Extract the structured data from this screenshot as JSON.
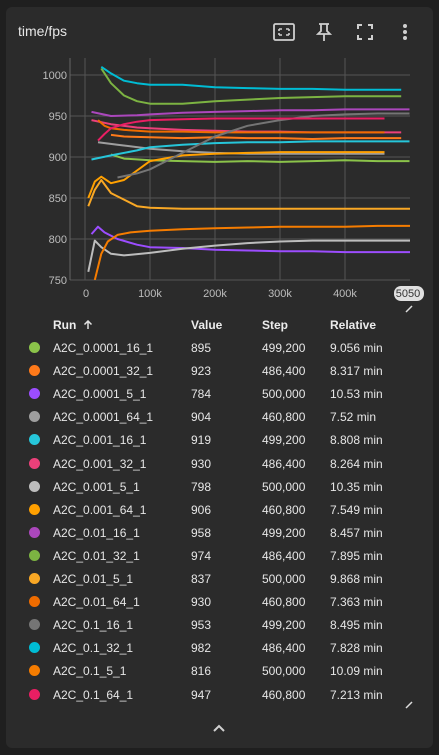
{
  "card": {
    "title": "time/fps"
  },
  "toolbar": {
    "fit_icon": "fit-domain-icon",
    "pin_icon": "pin-icon",
    "fullscreen_icon": "fullscreen-icon",
    "menu_icon": "more-vert-icon"
  },
  "chart_data": {
    "type": "line",
    "ylim": [
      750,
      1020
    ],
    "yticks": [
      "1000",
      "950",
      "900",
      "850",
      "800",
      "750"
    ],
    "xlim": [
      0,
      500000
    ],
    "xticks": [
      "0",
      "100k",
      "200k",
      "300k",
      "400k",
      "5050"
    ],
    "grid": true,
    "series": [
      {
        "name": "A2C_0.0001_16_1",
        "color": "#8bc34a",
        "x": [
          40000,
          60000,
          100000,
          150000,
          200000,
          250000,
          300000,
          350000,
          400000,
          450000,
          499200
        ],
        "y": [
          903,
          898,
          896,
          895,
          894,
          895,
          894,
          895,
          896,
          895,
          895
        ]
      },
      {
        "name": "A2C_0.0001_32_1",
        "color": "#ff7a1a",
        "x": [
          40000,
          60000,
          100000,
          150000,
          200000,
          250000,
          300000,
          350000,
          400000,
          450000,
          486400
        ],
        "y": [
          927,
          925,
          924,
          923,
          924,
          923,
          923,
          922,
          923,
          923,
          923
        ]
      },
      {
        "name": "A2C_0.0001_5_1",
        "color": "#9c4dff",
        "x": [
          10000,
          20000,
          30000,
          50000,
          80000,
          100000,
          150000,
          200000,
          250000,
          300000,
          350000,
          400000,
          450000,
          500000
        ],
        "y": [
          806,
          815,
          808,
          800,
          793,
          790,
          789,
          787,
          786,
          785,
          785,
          784,
          784,
          784
        ]
      },
      {
        "name": "A2C_0.0001_64_1",
        "color": "#9e9e9e",
        "x": [
          20000,
          50000,
          100000,
          150000,
          200000,
          250000,
          300000,
          350000,
          400000,
          460800
        ],
        "y": [
          918,
          915,
          910,
          907,
          905,
          904,
          904,
          904,
          904,
          904
        ]
      },
      {
        "name": "A2C_0.001_16_1",
        "color": "#26c6da",
        "x": [
          10000,
          40000,
          80000,
          100000,
          150000,
          200000,
          250000,
          300000,
          350000,
          400000,
          450000,
          499200
        ],
        "y": [
          897,
          902,
          908,
          912,
          915,
          917,
          918,
          918,
          919,
          919,
          919,
          919
        ]
      },
      {
        "name": "A2C_0.001_32_1",
        "color": "#ec407a",
        "x": [
          10000,
          40000,
          80000,
          100000,
          150000,
          200000,
          250000,
          300000,
          350000,
          400000,
          450000,
          486400
        ],
        "y": [
          945,
          940,
          936,
          935,
          933,
          932,
          931,
          931,
          930,
          930,
          930,
          930
        ]
      },
      {
        "name": "A2C_0.001_5_1",
        "color": "#bdbdbd",
        "x": [
          5000,
          15000,
          25000,
          40000,
          60000,
          100000,
          150000,
          200000,
          250000,
          300000,
          350000,
          400000,
          450000,
          500000
        ],
        "y": [
          760,
          798,
          790,
          782,
          780,
          783,
          788,
          792,
          795,
          797,
          798,
          798,
          798,
          798
        ]
      },
      {
        "name": "A2C_0.001_64_1",
        "color": "#ffa000",
        "x": [
          5000,
          15000,
          25000,
          40000,
          60000,
          100000,
          150000,
          200000,
          250000,
          300000,
          350000,
          400000,
          460800
        ],
        "y": [
          850,
          870,
          876,
          868,
          872,
          895,
          902,
          904,
          905,
          906,
          906,
          906,
          906
        ]
      },
      {
        "name": "A2C_0.01_16_1",
        "color": "#ab47bc",
        "x": [
          10000,
          40000,
          80000,
          100000,
          150000,
          200000,
          250000,
          300000,
          350000,
          400000,
          450000,
          499200
        ],
        "y": [
          955,
          950,
          951,
          952,
          954,
          955,
          956,
          957,
          957,
          958,
          958,
          958
        ]
      },
      {
        "name": "A2C_0.01_32_1",
        "color": "#7cb342",
        "x": [
          25000,
          40000,
          60000,
          80000,
          100000,
          150000,
          200000,
          250000,
          300000,
          350000,
          400000,
          450000,
          486400
        ],
        "y": [
          1008,
          990,
          975,
          968,
          965,
          965,
          968,
          970,
          972,
          973,
          974,
          974,
          974
        ]
      },
      {
        "name": "A2C_0.01_5_1",
        "color": "#f9a825",
        "x": [
          5000,
          15000,
          25000,
          40000,
          60000,
          80000,
          100000,
          150000,
          200000,
          250000,
          300000,
          350000,
          400000,
          450000,
          500000
        ],
        "y": [
          840,
          860,
          872,
          856,
          848,
          840,
          838,
          837,
          837,
          837,
          837,
          837,
          837,
          837,
          837
        ]
      },
      {
        "name": "A2C_0.01_64_1",
        "color": "#ef6c00",
        "x": [
          20000,
          30000,
          40000,
          60000,
          80000,
          100000,
          150000,
          200000,
          250000,
          300000,
          350000,
          400000,
          460800
        ],
        "y": [
          945,
          938,
          935,
          933,
          932,
          931,
          931,
          930,
          930,
          930,
          930,
          930,
          930
        ]
      },
      {
        "name": "A2C_0.1_16_1",
        "color": "#757575",
        "x": [
          50000,
          80000,
          100000,
          150000,
          200000,
          250000,
          300000,
          350000,
          400000,
          450000,
          499200
        ],
        "y": [
          875,
          880,
          885,
          905,
          925,
          938,
          945,
          950,
          952,
          953,
          953
        ]
      },
      {
        "name": "A2C_0.1_32_1",
        "color": "#00bcd4",
        "x": [
          25000,
          40000,
          60000,
          80000,
          100000,
          150000,
          200000,
          250000,
          300000,
          350000,
          400000,
          450000,
          486400
        ],
        "y": [
          1010,
          1002,
          993,
          990,
          988,
          988,
          985,
          984,
          983,
          983,
          982,
          982,
          982
        ]
      },
      {
        "name": "A2C_0.1_5_1",
        "color": "#f57c00",
        "x": [
          15000,
          25000,
          35000,
          50000,
          70000,
          100000,
          150000,
          200000,
          250000,
          300000,
          350000,
          400000,
          450000,
          500000
        ],
        "y": [
          750,
          782,
          797,
          805,
          808,
          810,
          812,
          813,
          814,
          815,
          815,
          815,
          816,
          816
        ]
      },
      {
        "name": "A2C_0.1_64_1",
        "color": "#e91e63",
        "x": [
          20000,
          30000,
          40000,
          60000,
          80000,
          100000,
          150000,
          200000,
          250000,
          300000,
          350000,
          400000,
          460800
        ],
        "y": [
          920,
          928,
          935,
          940,
          943,
          945,
          946,
          947,
          947,
          947,
          947,
          947,
          947
        ]
      }
    ]
  },
  "table": {
    "headers": {
      "run": "Run",
      "sort_icon": "sort-ascending-icon",
      "value": "Value",
      "step": "Step",
      "relative": "Relative"
    },
    "rows": [
      {
        "run": "A2C_0.0001_16_1",
        "value": "895",
        "step": "499,200",
        "relative": "9.056 min",
        "color": "#8bc34a"
      },
      {
        "run": "A2C_0.0001_32_1",
        "value": "923",
        "step": "486,400",
        "relative": "8.317 min",
        "color": "#ff7a1a"
      },
      {
        "run": "A2C_0.0001_5_1",
        "value": "784",
        "step": "500,000",
        "relative": "10.53 min",
        "color": "#9c4dff"
      },
      {
        "run": "A2C_0.0001_64_1",
        "value": "904",
        "step": "460,800",
        "relative": "7.52 min",
        "color": "#9e9e9e"
      },
      {
        "run": "A2C_0.001_16_1",
        "value": "919",
        "step": "499,200",
        "relative": "8.808 min",
        "color": "#26c6da"
      },
      {
        "run": "A2C_0.001_32_1",
        "value": "930",
        "step": "486,400",
        "relative": "8.264 min",
        "color": "#ec407a"
      },
      {
        "run": "A2C_0.001_5_1",
        "value": "798",
        "step": "500,000",
        "relative": "10.35 min",
        "color": "#bdbdbd"
      },
      {
        "run": "A2C_0.001_64_1",
        "value": "906",
        "step": "460,800",
        "relative": "7.549 min",
        "color": "#ffa000"
      },
      {
        "run": "A2C_0.01_16_1",
        "value": "958",
        "step": "499,200",
        "relative": "8.457 min",
        "color": "#ab47bc"
      },
      {
        "run": "A2C_0.01_32_1",
        "value": "974",
        "step": "486,400",
        "relative": "7.895 min",
        "color": "#7cb342"
      },
      {
        "run": "A2C_0.01_5_1",
        "value": "837",
        "step": "500,000",
        "relative": "9.868 min",
        "color": "#f9a825"
      },
      {
        "run": "A2C_0.01_64_1",
        "value": "930",
        "step": "460,800",
        "relative": "7.363 min",
        "color": "#ef6c00"
      },
      {
        "run": "A2C_0.1_16_1",
        "value": "953",
        "step": "499,200",
        "relative": "8.495 min",
        "color": "#757575"
      },
      {
        "run": "A2C_0.1_32_1",
        "value": "982",
        "step": "486,400",
        "relative": "7.828 min",
        "color": "#00bcd4"
      },
      {
        "run": "A2C_0.1_5_1",
        "value": "816",
        "step": "500,000",
        "relative": "10.09 min",
        "color": "#f57c00"
      },
      {
        "run": "A2C_0.1_64_1",
        "value": "947",
        "step": "460,800",
        "relative": "7.213 min",
        "color": "#e91e63"
      }
    ]
  },
  "footer": {
    "expand_icon": "chevron-up-icon"
  }
}
